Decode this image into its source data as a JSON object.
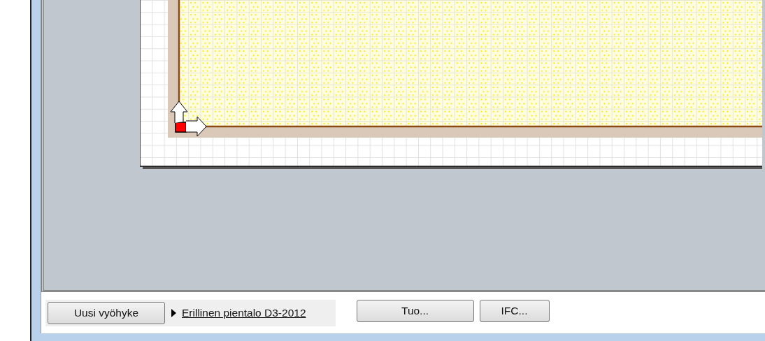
{
  "toolbar": {
    "new_zone_button": "Uusi vyöhyke",
    "zone": {
      "label": "Erillinen pientalo D3-2012",
      "expanded": false
    },
    "buttons": [
      "Tuo...",
      "IFC..."
    ]
  }
}
